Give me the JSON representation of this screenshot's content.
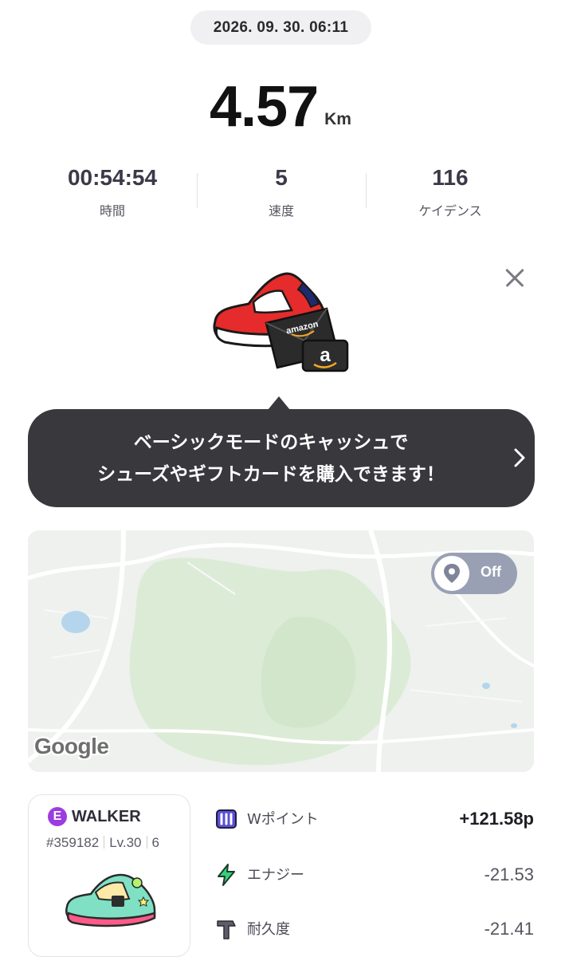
{
  "header": {
    "timestamp": "2026. 09. 30. 06:11"
  },
  "distance": {
    "value": "4.57",
    "unit": "Km"
  },
  "stats": [
    {
      "value": "00:54:54",
      "label": "時間"
    },
    {
      "value": "5",
      "label": "速度"
    },
    {
      "value": "116",
      "label": "ケイデンス"
    }
  ],
  "promo": {
    "line1": "ベーシックモードのキャッシュで",
    "line2": "シューズやギフトカードを購入できます！",
    "envelope_brand": "amazon",
    "card_letter": "a",
    "close_icon": "close-icon",
    "chevron_icon": "chevron-right-icon"
  },
  "map": {
    "toggle_label": "Off",
    "attribution": "Google",
    "toggle_icon": "location-pin-icon"
  },
  "sneaker": {
    "badge": "E",
    "type": "WALKER",
    "id": "#359182",
    "level": "Lv.30",
    "extra": "6",
    "badge_color": "#9c3ce0"
  },
  "rewards": [
    {
      "icon": "w-point-icon",
      "label": "Wポイント",
      "value": "+121.58p"
    },
    {
      "icon": "energy-bolt-icon",
      "label": "エナジー",
      "value": "-21.53"
    },
    {
      "icon": "durability-hammer-icon",
      "label": "耐久度",
      "value": "-21.41"
    }
  ]
}
